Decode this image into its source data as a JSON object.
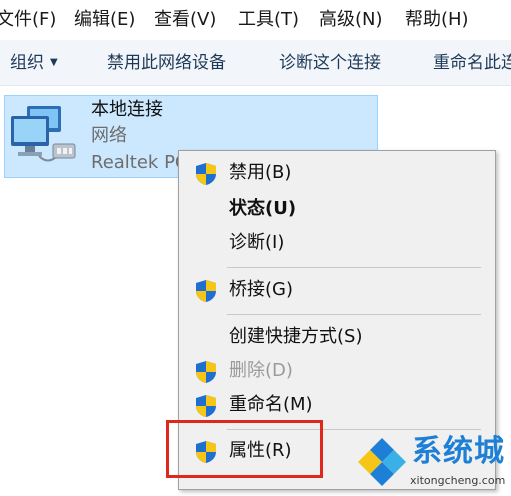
{
  "menubar": {
    "items": [
      "文件(F)",
      "编辑(E)",
      "查看(V)",
      "工具(T)",
      "高级(N)",
      "帮助(H)"
    ]
  },
  "commandbar": {
    "organize": "组织",
    "disable_device": "禁用此网络设备",
    "diagnose": "诊断这个连接",
    "rename": "重命名此连"
  },
  "connection": {
    "name": "本地连接",
    "status": "网络",
    "device": "Realtek PC",
    "icon": "network-adapter-icon"
  },
  "context_menu": {
    "items": [
      {
        "label": "禁用(B)",
        "shield": true,
        "disabled": false,
        "bold": false
      },
      {
        "label": "状态(U)",
        "shield": false,
        "disabled": false,
        "bold": true
      },
      {
        "label": "诊断(I)",
        "shield": false,
        "disabled": false,
        "bold": false
      },
      {
        "label": "桥接(G)",
        "shield": true,
        "disabled": false,
        "bold": false
      },
      {
        "label": "创建快捷方式(S)",
        "shield": false,
        "disabled": false,
        "bold": false
      },
      {
        "label": "删除(D)",
        "shield": true,
        "disabled": true,
        "bold": false
      },
      {
        "label": "重命名(M)",
        "shield": true,
        "disabled": false,
        "bold": false
      },
      {
        "label": "属性(R)",
        "shield": true,
        "disabled": false,
        "bold": false
      }
    ],
    "highlighted": "属性(R)"
  },
  "watermark": {
    "brand": "系统城",
    "url": "xitongcheng.com"
  },
  "colors": {
    "selection_bg": "#cce8ff",
    "highlight_border": "#e1261c",
    "shield_blue": "#1f6fd1",
    "shield_yellow": "#f5c518",
    "brand_blue": "#1e7fd6"
  }
}
